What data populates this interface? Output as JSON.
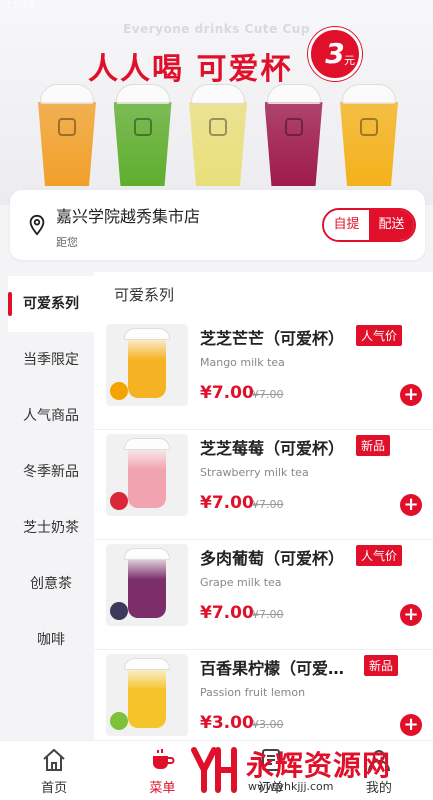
{
  "status_bar": {
    "time": "11:56"
  },
  "banner": {
    "tagline_en": "Everyone drinks Cute Cup",
    "tagline_zh": "人人喝 可爱杯",
    "price_number": "3",
    "price_unit": "元",
    "cup_colors": [
      "#f2a02a",
      "#5fae2e",
      "#e9df7a",
      "#9e1a4a",
      "#f4b21a"
    ]
  },
  "store": {
    "name": "嘉兴学院越秀集市店",
    "distance_label": "距您",
    "mode_pickup": "自提",
    "mode_delivery": "配送"
  },
  "sidebar": {
    "items": [
      {
        "label": "可爱系列",
        "active": true
      },
      {
        "label": "当季限定"
      },
      {
        "label": "人气商品"
      },
      {
        "label": "冬季新品"
      },
      {
        "label": "芝士奶茶"
      },
      {
        "label": "创意茶"
      },
      {
        "label": "咖啡"
      }
    ]
  },
  "section": {
    "title": "可爱系列"
  },
  "products": [
    {
      "name": "芝芝芒芒（可爱杯）",
      "tag": "人气价",
      "en": "Mango milk tea",
      "price": "¥7.00",
      "old_price": "¥7.00",
      "drink_color": "#f5b323",
      "fruit_color": "#f5a300"
    },
    {
      "name": "芝芝莓莓（可爱杯）",
      "tag": "新品",
      "en": "Strawberry milk tea",
      "price": "¥7.00",
      "old_price": "¥7.00",
      "drink_color": "#f2a3b0",
      "fruit_color": "#d8283a"
    },
    {
      "name": "多肉葡萄（可爱杯）",
      "tag": "人气价",
      "en": "Grape milk tea",
      "price": "¥7.00",
      "old_price": "¥7.00",
      "drink_color": "#7b2e6a",
      "fruit_color": "#3b3a5a"
    },
    {
      "name": "百香果柠檬（可爱杯）",
      "tag": "新品",
      "en": "Passion fruit lemon",
      "price": "¥3.00",
      "old_price": "¥3.00",
      "drink_color": "#f5c42b",
      "fruit_color": "#7fc13a"
    }
  ],
  "bottom_nav": {
    "home": "首页",
    "menu": "菜单",
    "orders": "订单",
    "mine": "我的"
  },
  "watermark": {
    "name": "永辉资源网",
    "url": "www.yhkjjj.com"
  },
  "colors": {
    "accent": "#e0102b"
  }
}
